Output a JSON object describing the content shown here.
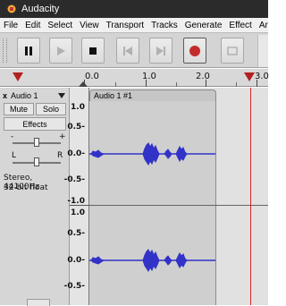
{
  "window": {
    "title": "Audacity"
  },
  "menu": [
    "File",
    "Edit",
    "Select",
    "View",
    "Transport",
    "Tracks",
    "Generate",
    "Effect",
    "Ana"
  ],
  "toolbar": {
    "pause": "Pause",
    "play": "Play",
    "stop": "Stop",
    "skip_start": "Skip to Start",
    "skip_end": "Skip to End",
    "record": "Record",
    "loop": "Loop"
  },
  "timeline": {
    "labels": [
      "0.0",
      "1.0",
      "2.0",
      "3.0"
    ]
  },
  "track": {
    "name": "Audio 1",
    "clip_name": "Audio 1 #1",
    "mute": "Mute",
    "solo": "Solo",
    "effects": "Effects",
    "gain_minus": "-",
    "gain_plus": "+",
    "pan_left": "L",
    "pan_right": "R",
    "info_line1": "Stereo, 44100Hz",
    "info_line2": "32-bit float",
    "close": "x"
  },
  "vertical_scale": {
    "channel1": [
      "1.0",
      "0.5-",
      "0.0-",
      "-0.5-",
      "-1.0"
    ],
    "channel2": [
      "1.0",
      "0.5-",
      "0.0-",
      "-0.5-"
    ]
  },
  "colors": {
    "waveform": "#3232c8",
    "cursor": "#d62828",
    "record": "#c42b2b"
  }
}
